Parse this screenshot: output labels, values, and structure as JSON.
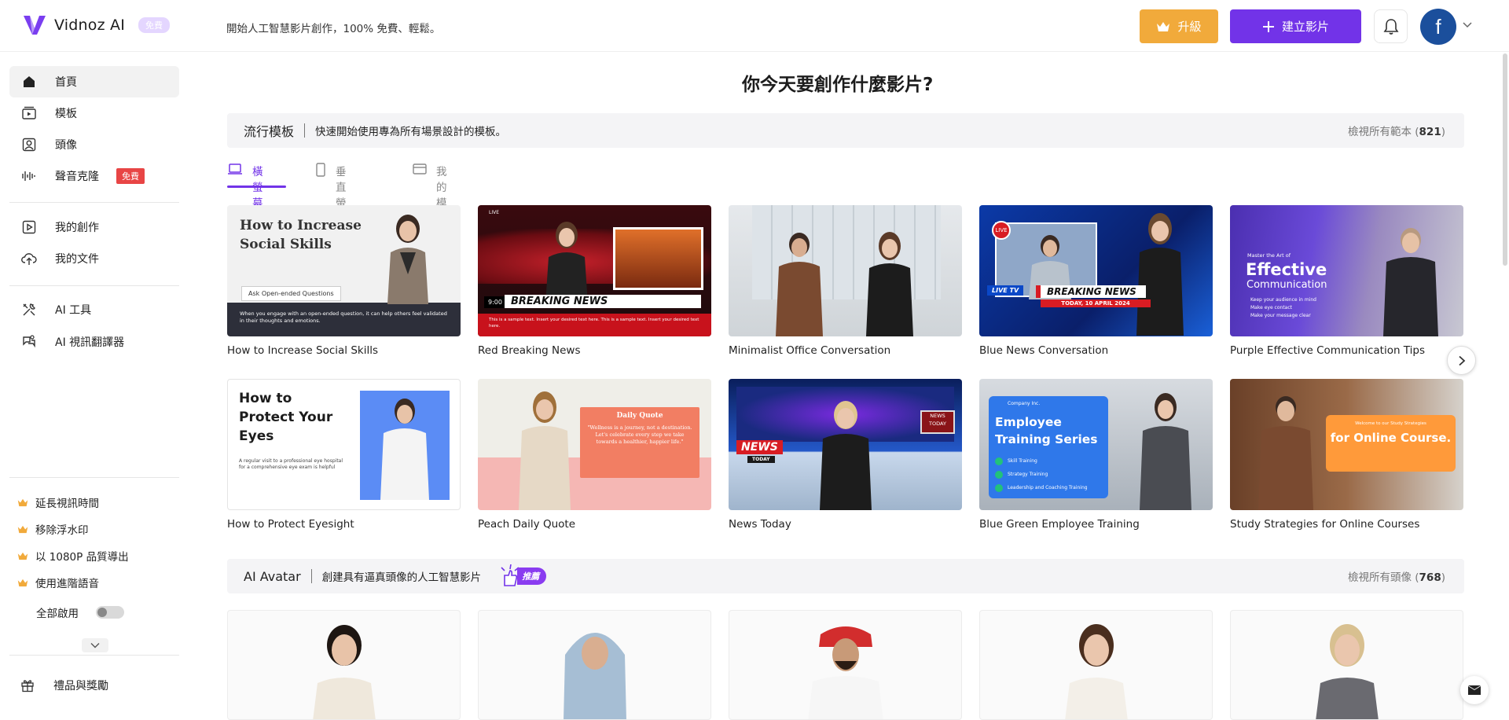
{
  "header": {
    "brand": "Vidnoz AI",
    "brand_badge": "免費",
    "tagline": "開始人工智慧影片創作，100% 免費、輕鬆。",
    "upgrade_label": "升級",
    "create_label": "建立影片",
    "avatar_letter": "f"
  },
  "sidebar": {
    "items": [
      {
        "label": "首頁",
        "icon": "home-icon"
      },
      {
        "label": "模板",
        "icon": "template-icon"
      },
      {
        "label": "頭像",
        "icon": "avatar-icon"
      },
      {
        "label": "聲音克隆",
        "icon": "voice-icon",
        "badge": "免費"
      },
      {
        "label": "我的創作",
        "icon": "my-creations-icon"
      },
      {
        "label": "我的文件",
        "icon": "upload-icon"
      },
      {
        "label": "AI 工具",
        "icon": "tools-icon"
      },
      {
        "label": "AI 視訊翻譯器",
        "icon": "translate-icon"
      }
    ],
    "perks": [
      "延長視訊時間",
      "移除浮水印",
      "以 1080P 品質導出",
      "使用進階語音"
    ],
    "enable_all": "全部啟用",
    "gift": "禮品與獎勵"
  },
  "main": {
    "title": "你今天要創作什麼影片?",
    "templates_section": {
      "title": "流行模板",
      "desc": "快速開始使用專為所有場景設計的模板。",
      "view_all": "檢視所有範本 (",
      "count": "821",
      "view_all_end": ")"
    },
    "tabs": [
      {
        "label": "橫螢幕",
        "icon": "laptop-icon",
        "active": true
      },
      {
        "label": "垂直螢幕",
        "icon": "phone-icon",
        "active": false
      },
      {
        "label": "我的模板",
        "icon": "folder-icon",
        "active": false
      }
    ],
    "templates_row1": [
      {
        "title": "How to Increase Social Skills",
        "thumb_h": "How to Increase Social Skills",
        "thumb_sub": "Ask Open-ended Questions",
        "thumb_foot": "When you engage with an open-ended question, it can help others feel validated in their thoughts and emotions."
      },
      {
        "title": "Red Breaking News",
        "thumb_h": "BREAKING NEWS",
        "thumb_time": "9:00",
        "thumb_live": "LIVE",
        "thumb_foot": "This is a sample text. Insert your desired text here. This is a sample text. Insert your desired text here."
      },
      {
        "title": "Minimalist Office Conversation"
      },
      {
        "title": "Blue News Conversation",
        "thumb_h": "BREAKING NEWS",
        "thumb_live": "LIVE",
        "thumb_livetv": "LIVE TV",
        "thumb_date": "TODAY, 10 APRIL 2024"
      },
      {
        "title": "Purple Effective Communication Tips",
        "thumb_pre": "Master the Art of",
        "thumb_h1": "Effective",
        "thumb_h2": "Communication",
        "thumb_bullets": [
          "Keep your audience in mind",
          "Make eye contact",
          "Make your message clear"
        ]
      }
    ],
    "templates_row2": [
      {
        "title": "How to Protect Eyesight",
        "thumb_h": "How to Protect Your Eyes",
        "thumb_sub": "A regular visit to a professional eye hospital for a comprehensive eye exam is helpful"
      },
      {
        "title": "Peach Daily Quote",
        "thumb_h": "Daily Quote",
        "thumb_sub": "\"Wellness is a journey, not a destination. Let's celebrate every step we take towards a healthier, happier life.\""
      },
      {
        "title": "News Today",
        "thumb_h": "NEWS",
        "thumb_sub": "TODAY",
        "thumb_screen": "NEWS TODAY"
      },
      {
        "title": "Blue Green Employee Training",
        "thumb_company": "Company Inc.",
        "thumb_h": "Employee Training Series",
        "thumb_items": [
          "Skill Training",
          "Strategy Training",
          "Leadership and Coaching Training"
        ]
      },
      {
        "title": "Study Strategies for Online Courses",
        "thumb_pre": "Welcome to our Study Strategies",
        "thumb_h": "for Online Course."
      }
    ],
    "avatar_section": {
      "title": "AI Avatar",
      "desc": "創建具有逼真頭像的人工智慧影片",
      "hot": "推薦",
      "view_all": "檢視所有頭像 (",
      "count": "768",
      "view_all_end": ")"
    }
  },
  "colors": {
    "accent": "#7233e8",
    "upgrade": "#f1aa3b",
    "badge_red": "#e84545",
    "avatar_bg": "#1b4f9c"
  }
}
